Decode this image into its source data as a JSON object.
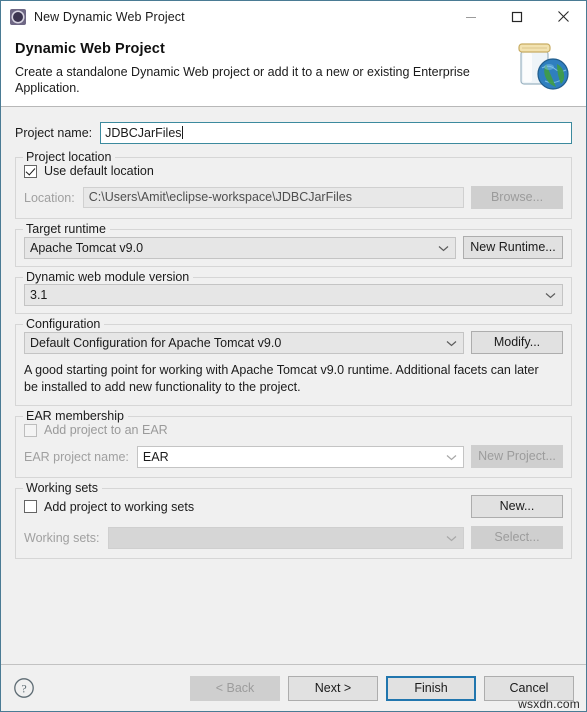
{
  "window": {
    "title": "New Dynamic Web Project",
    "icon": "eclipse-wizard-icon",
    "minimize_label": "—",
    "maximize_label": "□",
    "close_label": "×"
  },
  "header": {
    "title": "Dynamic Web Project",
    "subtitle": "Create a standalone Dynamic Web project or add it to a new or existing Enterprise Application.",
    "banner_icon": "jar-with-globe-icon"
  },
  "project_name": {
    "label": "Project name:",
    "value": "JDBCJarFiles",
    "placeholder": ""
  },
  "project_location": {
    "group_label": "Project location",
    "use_default_label": "Use default location",
    "use_default_checked": true,
    "location_label": "Location:",
    "location_value": "C:\\Users\\Amit\\eclipse-workspace\\JDBCJarFiles",
    "browse_label": "Browse...",
    "browse_enabled": false
  },
  "target_runtime": {
    "group_label": "Target runtime",
    "selected": "Apache Tomcat v9.0",
    "new_runtime_label": "New Runtime...",
    "options": [
      "Apache Tomcat v9.0"
    ]
  },
  "module_version": {
    "group_label": "Dynamic web module version",
    "selected": "3.1",
    "options": [
      "3.1"
    ]
  },
  "configuration": {
    "group_label": "Configuration",
    "selected": "Default Configuration for Apache Tomcat v9.0",
    "modify_label": "Modify...",
    "description": "A good starting point for working with Apache Tomcat v9.0 runtime. Additional facets can later be installed to add new functionality to the project.",
    "options": [
      "Default Configuration for Apache Tomcat v9.0"
    ]
  },
  "ear_membership": {
    "group_label": "EAR membership",
    "add_to_ear_label": "Add project to an EAR",
    "add_to_ear_checked": false,
    "ear_project_name_label": "EAR project name:",
    "ear_project_name_value": "EAR",
    "new_project_label": "New Project...",
    "new_project_enabled": false
  },
  "working_sets": {
    "group_label": "Working sets",
    "add_to_working_sets_label": "Add project to working sets",
    "add_to_working_sets_checked": false,
    "new_label": "New...",
    "working_sets_label": "Working sets:",
    "working_sets_value": "",
    "select_label": "Select...",
    "select_enabled": false
  },
  "footer": {
    "help_icon": "help-question-icon",
    "back_label": "< Back",
    "back_enabled": false,
    "next_label": "Next >",
    "finish_label": "Finish",
    "cancel_label": "Cancel",
    "primary_button": "Finish",
    "watermark": "wsxdn.com"
  },
  "colors": {
    "dialog_border": "#4a7b94",
    "focus_border": "#3c8a9e",
    "primary_button_border": "#2176ae",
    "background": "#f0f0f0",
    "header_background": "#ffffff"
  }
}
